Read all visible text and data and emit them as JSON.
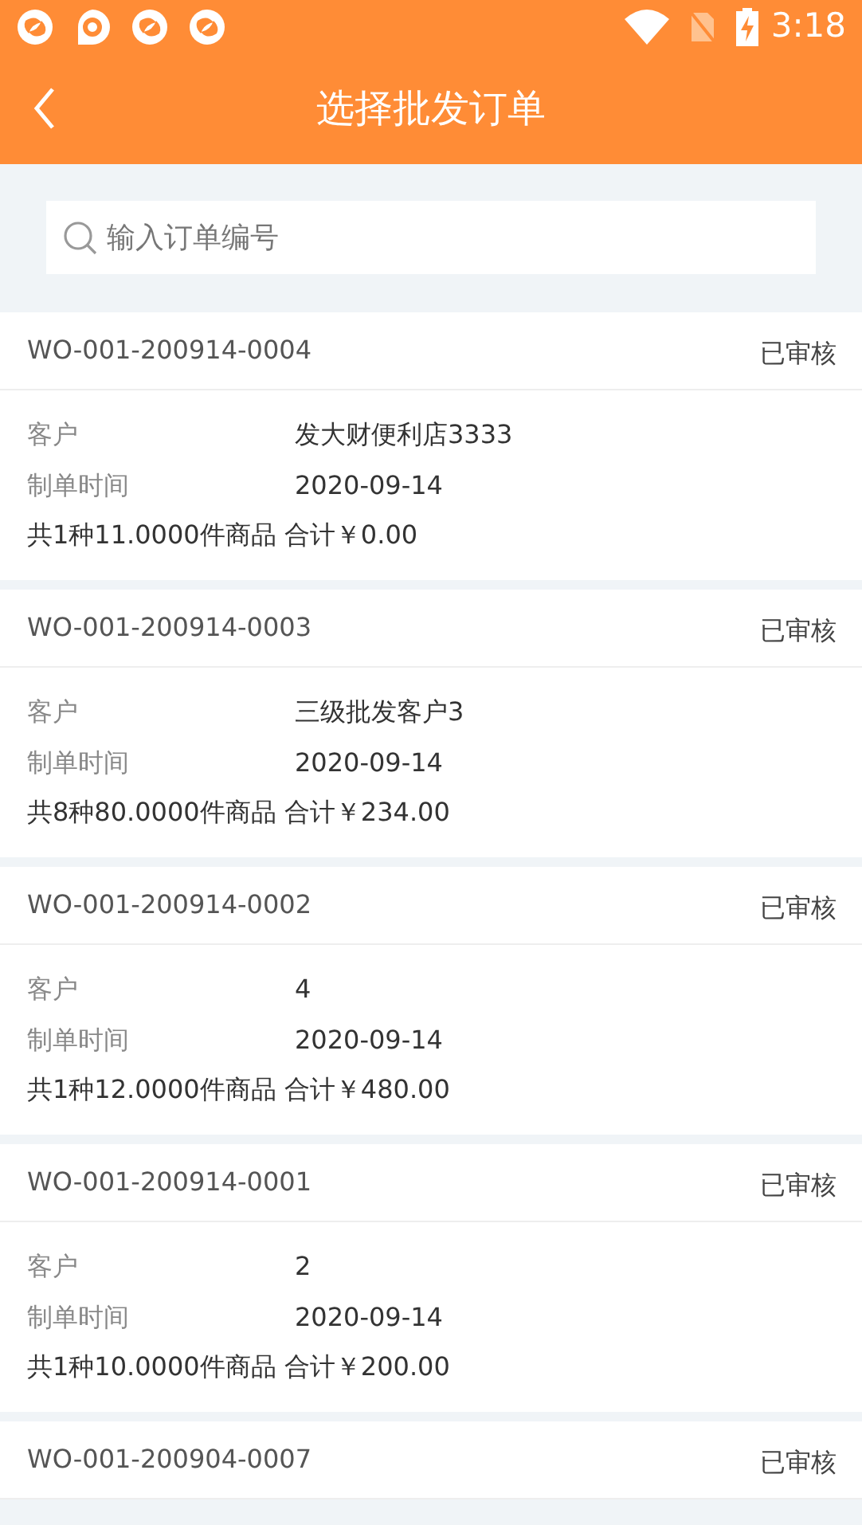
{
  "status_bar": {
    "time": "3:18"
  },
  "header": {
    "title": "选择批发订单"
  },
  "search": {
    "placeholder": "输入订单编号"
  },
  "orders": [
    {
      "number": "WO-001-200914-0004",
      "status": "已审核",
      "customer_label": "客户",
      "customer": "发大财便利店3333",
      "date_label": "制单时间",
      "date": "2020-09-14",
      "summary": "共1种11.0000件商品 合计￥0.00"
    },
    {
      "number": "WO-001-200914-0003",
      "status": "已审核",
      "customer_label": "客户",
      "customer": "三级批发客户3",
      "date_label": "制单时间",
      "date": "2020-09-14",
      "summary": "共8种80.0000件商品 合计￥234.00"
    },
    {
      "number": "WO-001-200914-0002",
      "status": "已审核",
      "customer_label": "客户",
      "customer": "4",
      "date_label": "制单时间",
      "date": "2020-09-14",
      "summary": "共1种12.0000件商品 合计￥480.00"
    },
    {
      "number": "WO-001-200914-0001",
      "status": "已审核",
      "customer_label": "客户",
      "customer": "2",
      "date_label": "制单时间",
      "date": "2020-09-14",
      "summary": "共1种10.0000件商品 合计￥200.00"
    },
    {
      "number": "WO-001-200904-0007",
      "status": "已审核"
    }
  ]
}
